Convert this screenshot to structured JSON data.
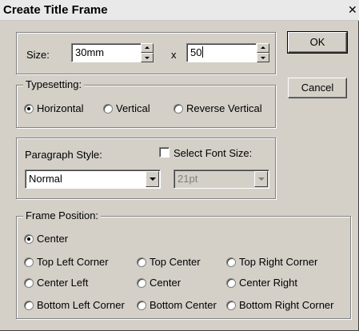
{
  "window": {
    "title": "Create Title Frame",
    "close_glyph": "✕"
  },
  "size": {
    "label": "Size:",
    "width_value": "30mm",
    "separator": "x",
    "height_value": "50"
  },
  "buttons": {
    "ok": "OK",
    "cancel": "Cancel"
  },
  "typesetting": {
    "legend": "Typesetting:",
    "options": [
      "Horizontal",
      "Vertical",
      "Reverse Vertical"
    ],
    "selected": "Horizontal"
  },
  "paragraph": {
    "label": "Paragraph Style:",
    "style_value": "Normal",
    "select_font_label": "Select Font Size:",
    "select_font_checked": false,
    "font_size_value": "21pt"
  },
  "frame_position": {
    "legend": "Frame Position:",
    "center": "Center",
    "options": [
      [
        "Top Left Corner",
        "Top Center",
        "Top Right Corner"
      ],
      [
        "Center Left",
        "Center",
        "Center Right"
      ],
      [
        "Bottom Left Corner",
        "Bottom Center",
        "Bottom Right Corner"
      ]
    ],
    "selected": "Center"
  },
  "icons": [
    "close-icon",
    "spin-up-icon",
    "spin-down-icon",
    "dropdown-arrow-icon",
    "radio-icon",
    "checkbox-icon"
  ]
}
